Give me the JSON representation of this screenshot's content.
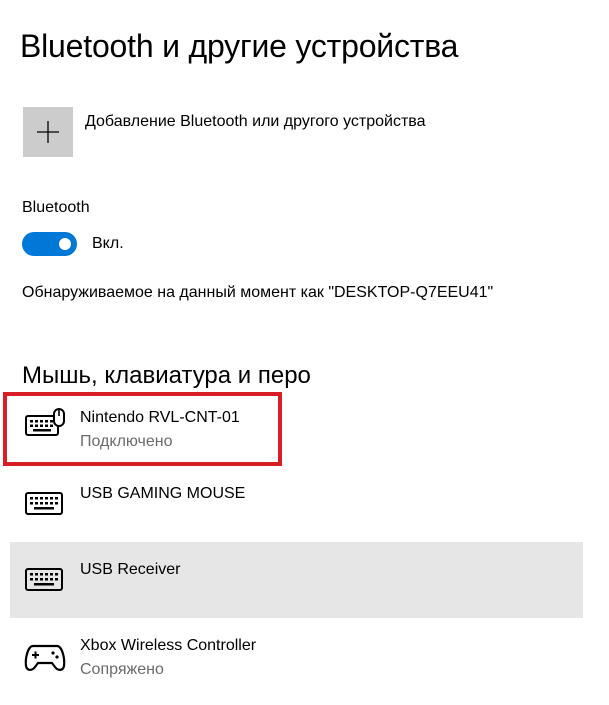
{
  "page": {
    "title": "Bluetooth и другие устройства"
  },
  "add_device": {
    "label": "Добавление Bluetooth или другого устройства",
    "icon": "plus-icon"
  },
  "bluetooth": {
    "label": "Bluetooth",
    "toggle_on": true,
    "toggle_state_label": "Вкл.",
    "accent_color": "#0078d7",
    "discoverable_text": "Обнаруживаемое на данный момент как \"DESKTOP-Q7EEU41\""
  },
  "section": {
    "heading": "Мышь, клавиатура и перо"
  },
  "devices": [
    {
      "name": "Nintendo RVL-CNT-01",
      "status": "Подключено",
      "icon": "keyboard-mouse-icon",
      "highlighted": true,
      "highlight_color": "#d81d25"
    },
    {
      "name": "USB GAMING MOUSE",
      "status": "",
      "icon": "keyboard-icon"
    },
    {
      "name": "USB Receiver",
      "status": "",
      "icon": "keyboard-icon",
      "selected": true
    },
    {
      "name": "Xbox Wireless Controller",
      "status": "Сопряжено",
      "icon": "gamepad-icon"
    }
  ]
}
